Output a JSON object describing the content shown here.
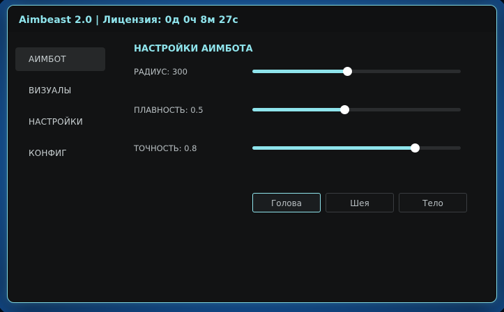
{
  "window": {
    "title": "Aimbeast 2.0 | Лицензия: 0д 0ч 8м 27с"
  },
  "sidebar": {
    "items": [
      {
        "label": "АИМБОТ",
        "active": true
      },
      {
        "label": "ВИЗУАЛЫ",
        "active": false
      },
      {
        "label": "НАСТРОЙКИ",
        "active": false
      },
      {
        "label": "КОНФИГ",
        "active": false
      }
    ]
  },
  "main": {
    "section_title": "НАСТРОЙКИ АИМБОТА",
    "sliders": [
      {
        "label": "РАДИУС: 300",
        "fraction": 0.455
      },
      {
        "label": "ПЛАВНОСТЬ: 0.5",
        "fraction": 0.44
      },
      {
        "label": "ТОЧНОСТЬ: 0.8",
        "fraction": 0.78
      }
    ],
    "target_buttons": [
      {
        "label": "Голова",
        "active": true
      },
      {
        "label": "Шея",
        "active": false
      },
      {
        "label": "Тело",
        "active": false
      }
    ]
  },
  "colors": {
    "accent": "#8fe4ec",
    "panel_bg": "#121314",
    "active_item_bg": "#262829"
  }
}
